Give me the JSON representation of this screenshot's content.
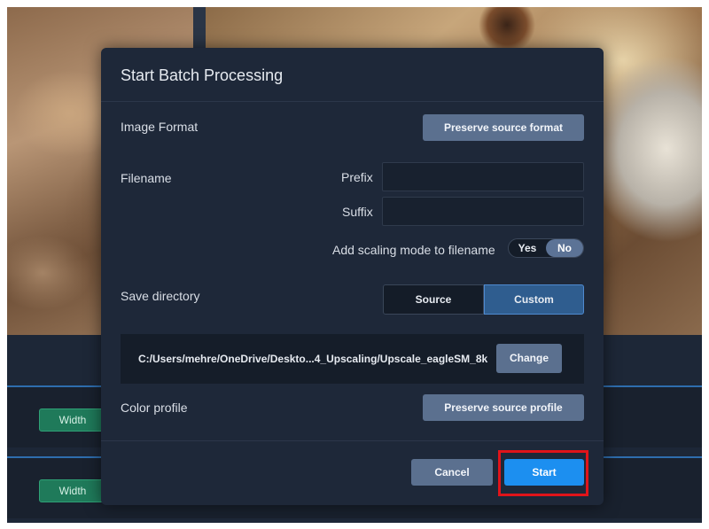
{
  "background": {
    "row_chip_1": "Width",
    "row_chip_2": "Width"
  },
  "dialog": {
    "title": "Start Batch Processing",
    "image_format": {
      "label": "Image Format",
      "button": "Preserve source format"
    },
    "filename": {
      "label": "Filename",
      "prefix_label": "Prefix",
      "prefix_value": "",
      "suffix_label": "Suffix",
      "suffix_value": "",
      "scaling_mode_label": "Add scaling mode to filename",
      "toggle_yes": "Yes",
      "toggle_no": "No",
      "toggle_selected": "No"
    },
    "save_directory": {
      "label": "Save directory",
      "option_source": "Source",
      "option_custom": "Custom",
      "selected": "Custom",
      "path": "C:/Users/mehre/OneDrive/Deskto...4_Upscaling/Upscale_eagleSM_8k",
      "change_button": "Change"
    },
    "color_profile": {
      "label": "Color profile",
      "button": "Preserve source profile"
    },
    "footer": {
      "cancel": "Cancel",
      "start": "Start"
    }
  },
  "colors": {
    "dialog_bg": "#1e2839",
    "button_gray": "#5b708f",
    "start_blue": "#1c8ff0",
    "highlight_red": "#e0141a"
  }
}
